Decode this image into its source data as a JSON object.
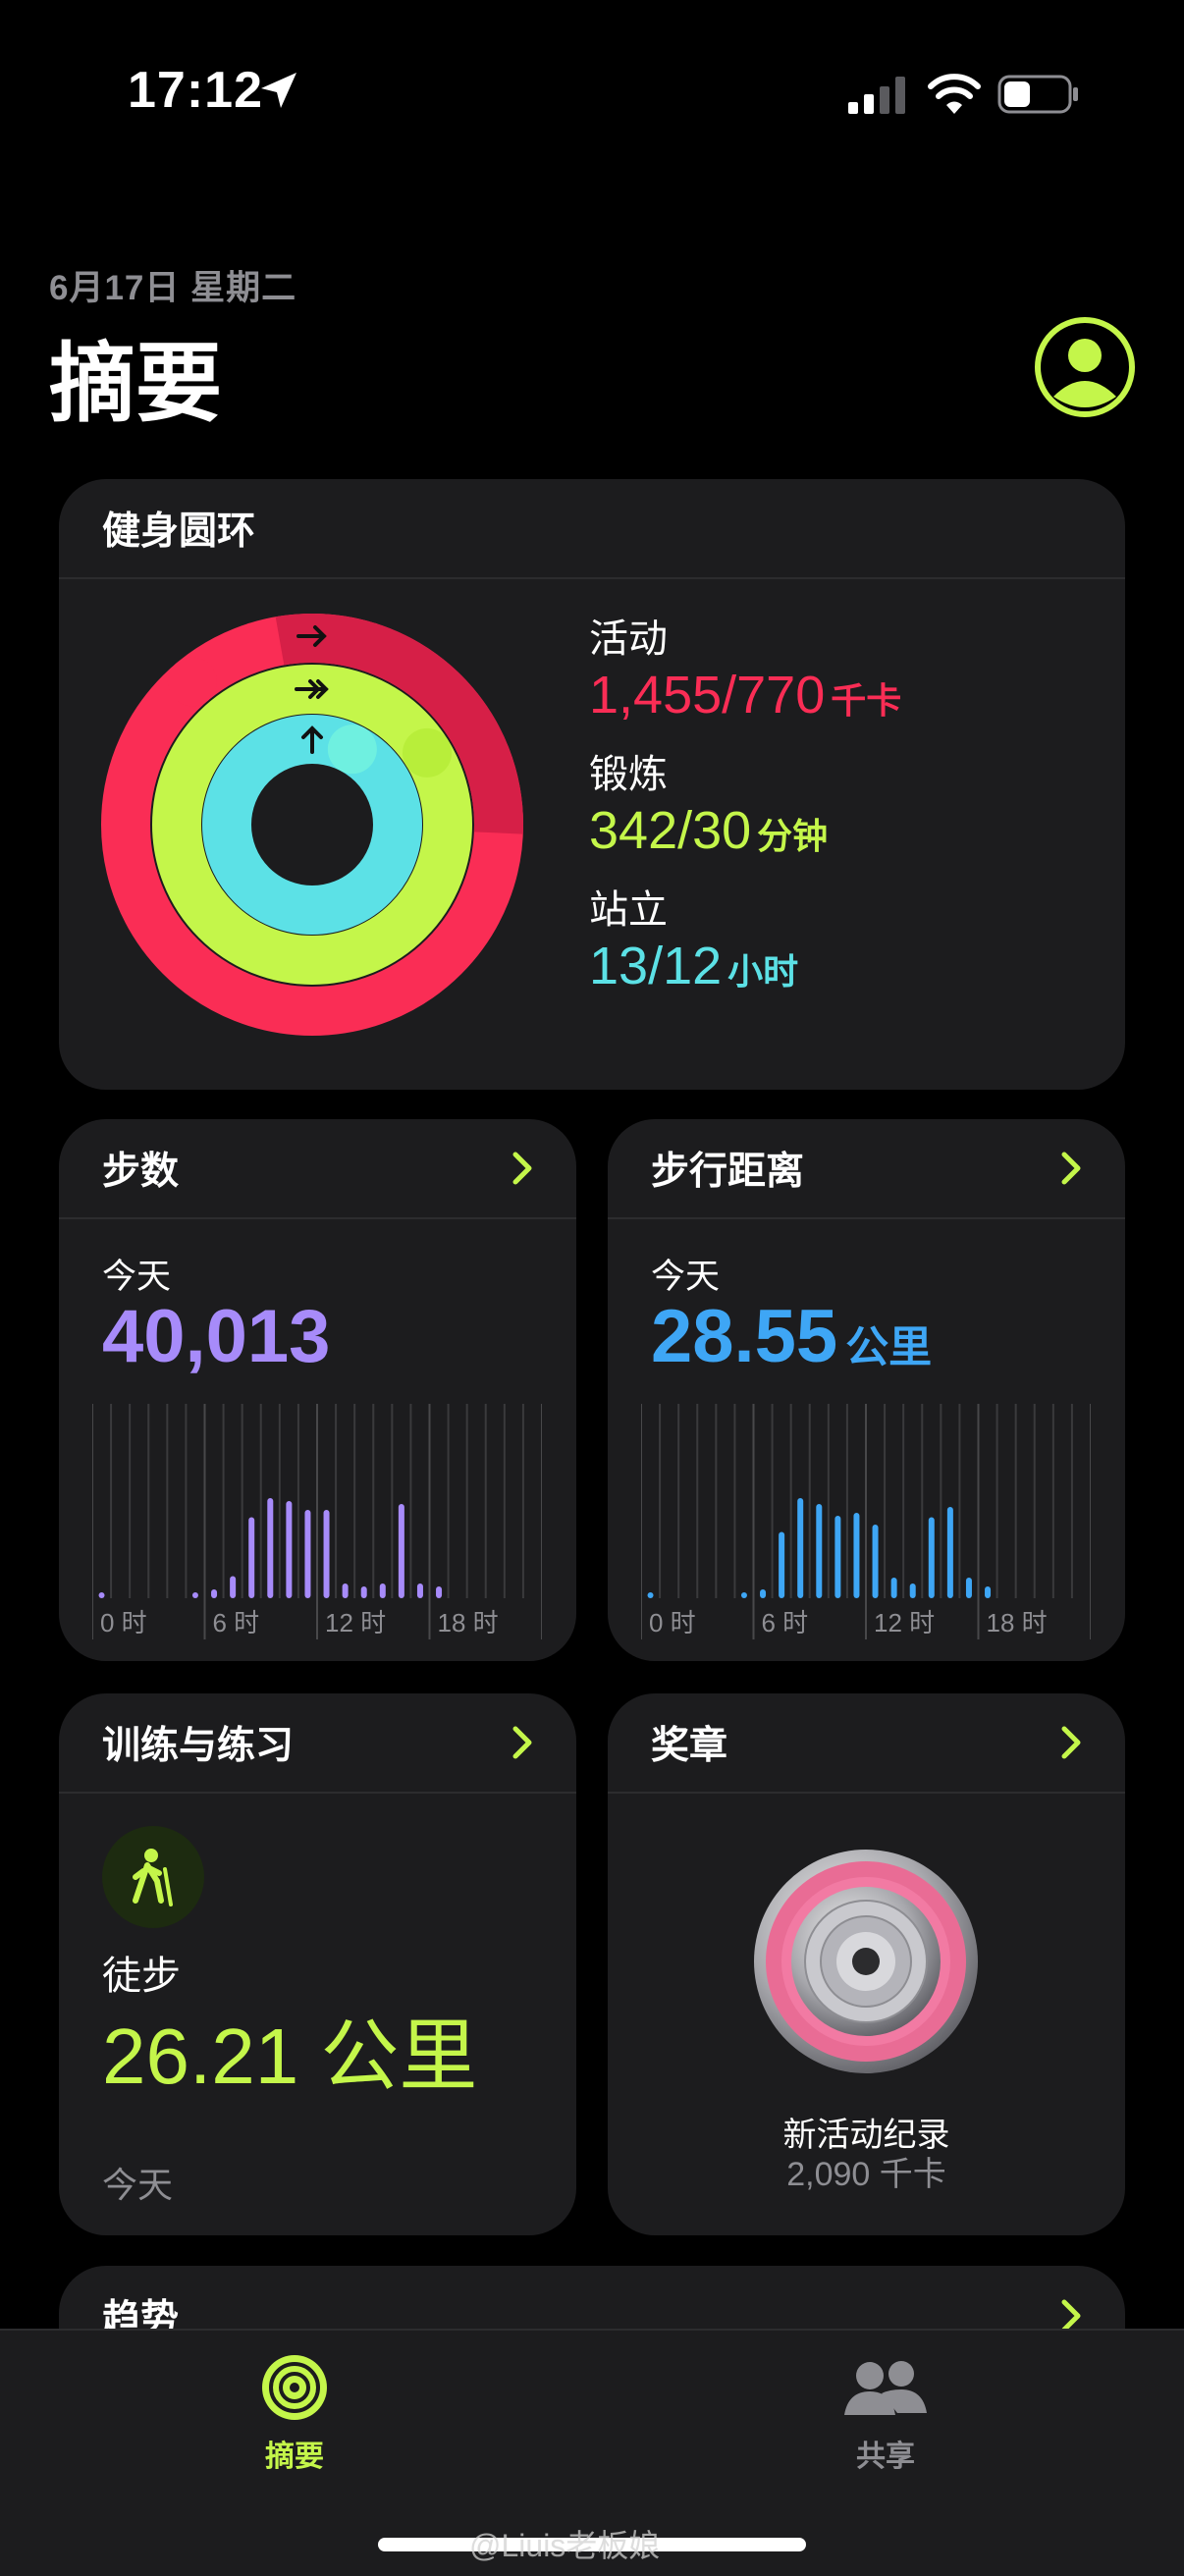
{
  "status_bar": {
    "time": "17:12"
  },
  "header": {
    "date": "6月17日 星期二",
    "title": "摘要"
  },
  "rings": {
    "title": "健身圆环",
    "move": {
      "label": "活动",
      "value": "1,455/770",
      "unit": "千卡",
      "progress": 1.89,
      "color": "#fa2d55"
    },
    "exercise": {
      "label": "锻炼",
      "value": "342/30",
      "unit": "分钟",
      "progress": 11.4,
      "color": "#c4f64a"
    },
    "stand": {
      "label": "站立",
      "value": "13/12",
      "unit": "小时",
      "progress": 1.08,
      "color": "#5ce1e6"
    }
  },
  "steps": {
    "title": "步数",
    "today_label": "今天",
    "value": "40,013",
    "color": "#a78bfa",
    "hourly": [
      0.04,
      0,
      0,
      0,
      0,
      0.04,
      0.06,
      0.15,
      0.55,
      0.68,
      0.66,
      0.6,
      0.6,
      0.1,
      0.08,
      0.1,
      0.64,
      0.1,
      0.08,
      0,
      0,
      0,
      0,
      0
    ],
    "ticks": [
      "0 时",
      "6 时",
      "12 时",
      "18 时"
    ]
  },
  "distance": {
    "title": "步行距离",
    "today_label": "今天",
    "value": "28.55",
    "unit": "公里",
    "color": "#3ea6f5",
    "hourly": [
      0.04,
      0,
      0,
      0,
      0,
      0.04,
      0.06,
      0.45,
      0.68,
      0.64,
      0.56,
      0.58,
      0.5,
      0.14,
      0.1,
      0.55,
      0.62,
      0.14,
      0.08,
      0,
      0,
      0,
      0,
      0
    ],
    "ticks": [
      "0 时",
      "6 时",
      "12 时",
      "18 时"
    ]
  },
  "workouts": {
    "title": "训练与练习",
    "name": "徒步",
    "value": "26.21 公里",
    "date": "今天",
    "icon": "hiking-icon"
  },
  "awards": {
    "title": "奖章",
    "name": "新活动纪录",
    "value": "2,090 千卡",
    "icon": "medal-icon"
  },
  "trends": {
    "title": "趋势"
  },
  "tabbar": {
    "summary": "摘要",
    "sharing": "共享",
    "active_color": "#c4f64a",
    "inactive_color": "#8e8e93"
  },
  "watermark": "@Liuis老板娘"
}
